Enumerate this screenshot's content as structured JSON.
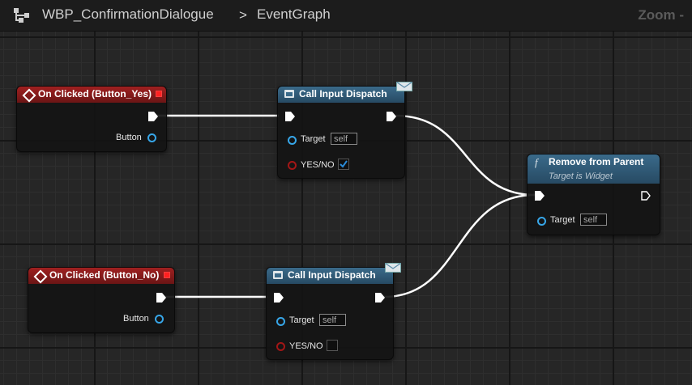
{
  "breadcrumb": {
    "blueprint": "WBP_ConfirmationDialogue",
    "separator": ">",
    "graph": "EventGraph"
  },
  "zoom_label": "Zoom -",
  "nodes": {
    "event_yes": {
      "title": "On Clicked (Button_Yes)",
      "output_label": "Button"
    },
    "event_no": {
      "title": "On Clicked (Button_No)",
      "output_label": "Button"
    },
    "call_yes": {
      "title": "Call Input Dispatch",
      "target_label": "Target",
      "target_value": "self",
      "bool_label": "YES/NO",
      "bool_value": true
    },
    "call_no": {
      "title": "Call Input Dispatch",
      "target_label": "Target",
      "target_value": "self",
      "bool_label": "YES/NO",
      "bool_value": false
    },
    "remove": {
      "title": "Remove from Parent",
      "subtitle": "Target is Widget",
      "target_label": "Target",
      "target_value": "self"
    }
  },
  "icons": {
    "graph": "graph-icon",
    "event": "event-diamond-icon",
    "call": "call-function-icon",
    "message": "envelope-icon",
    "func": "function-icon"
  },
  "colors": {
    "event_header": "#a02020",
    "call_header": "#3a6a8a",
    "object_pin": "#37a6e8",
    "bool_pin": "#a31616",
    "exec_wire": "#ffffff",
    "check": "#2a8bd8"
  }
}
